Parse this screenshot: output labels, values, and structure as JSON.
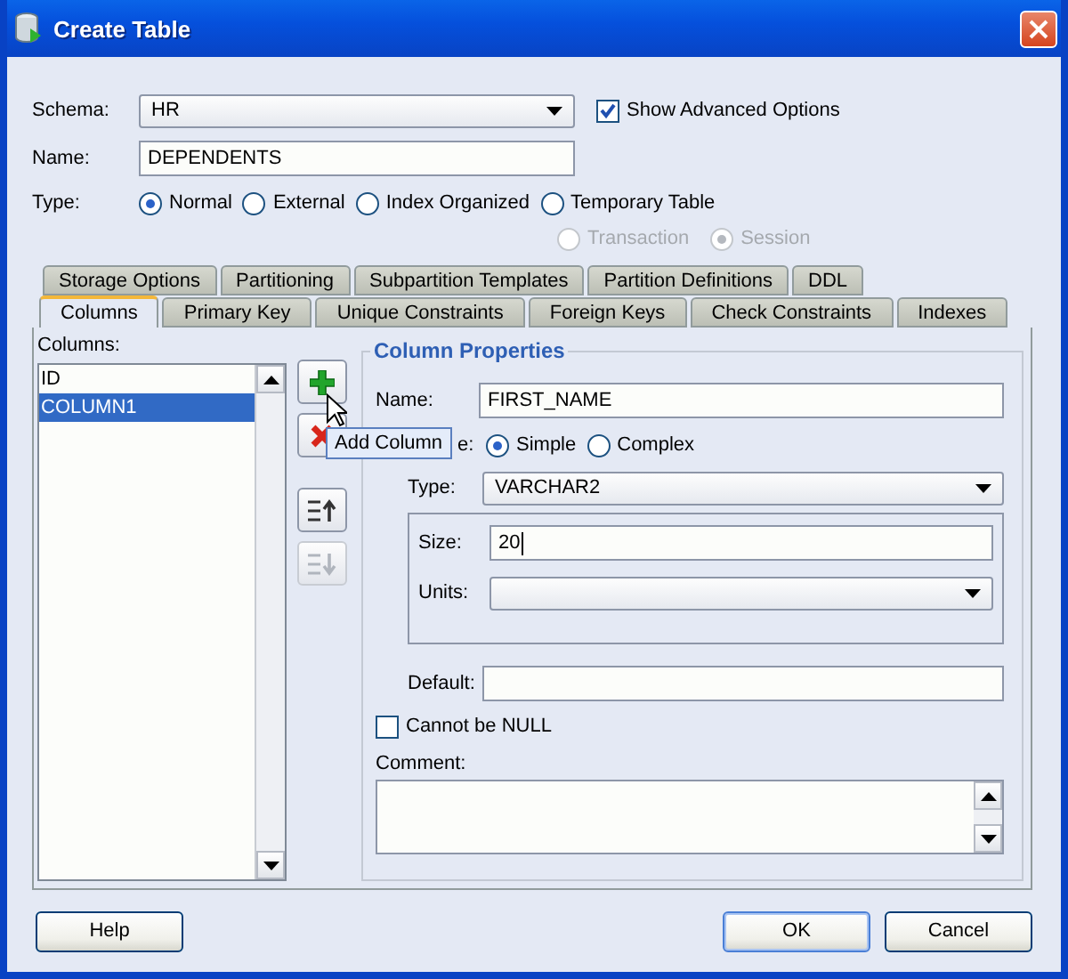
{
  "window": {
    "title": "Create Table"
  },
  "schema": {
    "label": "Schema:",
    "value": "HR"
  },
  "show_advanced": {
    "label": "Show Advanced Options",
    "checked": true
  },
  "name": {
    "label": "Name:",
    "value": "DEPENDENTS"
  },
  "table_type": {
    "label": "Type:",
    "options": [
      {
        "label": "Normal",
        "selected": true
      },
      {
        "label": "External",
        "selected": false
      },
      {
        "label": "Index Organized",
        "selected": false
      },
      {
        "label": "Temporary Table",
        "selected": false
      }
    ]
  },
  "temporary_options": [
    {
      "label": "Transaction",
      "selected": false,
      "disabled": true
    },
    {
      "label": "Session",
      "selected": true,
      "disabled": true
    }
  ],
  "tabs_back": [
    {
      "label": "Storage Options",
      "selected": false
    },
    {
      "label": "Partitioning",
      "selected": false
    },
    {
      "label": "Subpartition Templates",
      "selected": false
    },
    {
      "label": "Partition Definitions",
      "selected": false
    },
    {
      "label": "DDL",
      "selected": false
    }
  ],
  "tabs_front": [
    {
      "label": "Columns",
      "selected": true
    },
    {
      "label": "Primary Key",
      "selected": false
    },
    {
      "label": "Unique Constraints",
      "selected": false
    },
    {
      "label": "Foreign Keys",
      "selected": false
    },
    {
      "label": "Check Constraints",
      "selected": false
    },
    {
      "label": "Indexes",
      "selected": false
    }
  ],
  "columns_list": {
    "label": "Columns:",
    "items": [
      {
        "label": "ID",
        "selected": false
      },
      {
        "label": "COLUMN1",
        "selected": true
      }
    ]
  },
  "column_buttons": [
    {
      "kind": "add",
      "disabled": false
    },
    {
      "kind": "delete",
      "disabled": false
    },
    {
      "kind": "up",
      "disabled": false
    },
    {
      "kind": "down",
      "disabled": true
    }
  ],
  "tooltip": "Add Column",
  "properties": {
    "title": "Column Properties",
    "name": {
      "label": "Name:",
      "value": "FIRST_NAME"
    },
    "kind": {
      "label": "e:",
      "options": [
        {
          "label": "Simple",
          "selected": true
        },
        {
          "label": "Complex",
          "selected": false
        }
      ]
    },
    "type": {
      "label": "Type:",
      "value": "VARCHAR2"
    },
    "size": {
      "label": "Size:",
      "value": "20"
    },
    "units": {
      "label": "Units:"
    },
    "default": {
      "label": "Default:"
    },
    "not_null": {
      "label": "Cannot be NULL",
      "checked": false
    },
    "comment": {
      "label": "Comment:"
    }
  },
  "buttons": [
    {
      "label": "Help",
      "default": false
    },
    {
      "label": "OK",
      "default": true
    },
    {
      "label": "Cancel",
      "default": false
    }
  ]
}
